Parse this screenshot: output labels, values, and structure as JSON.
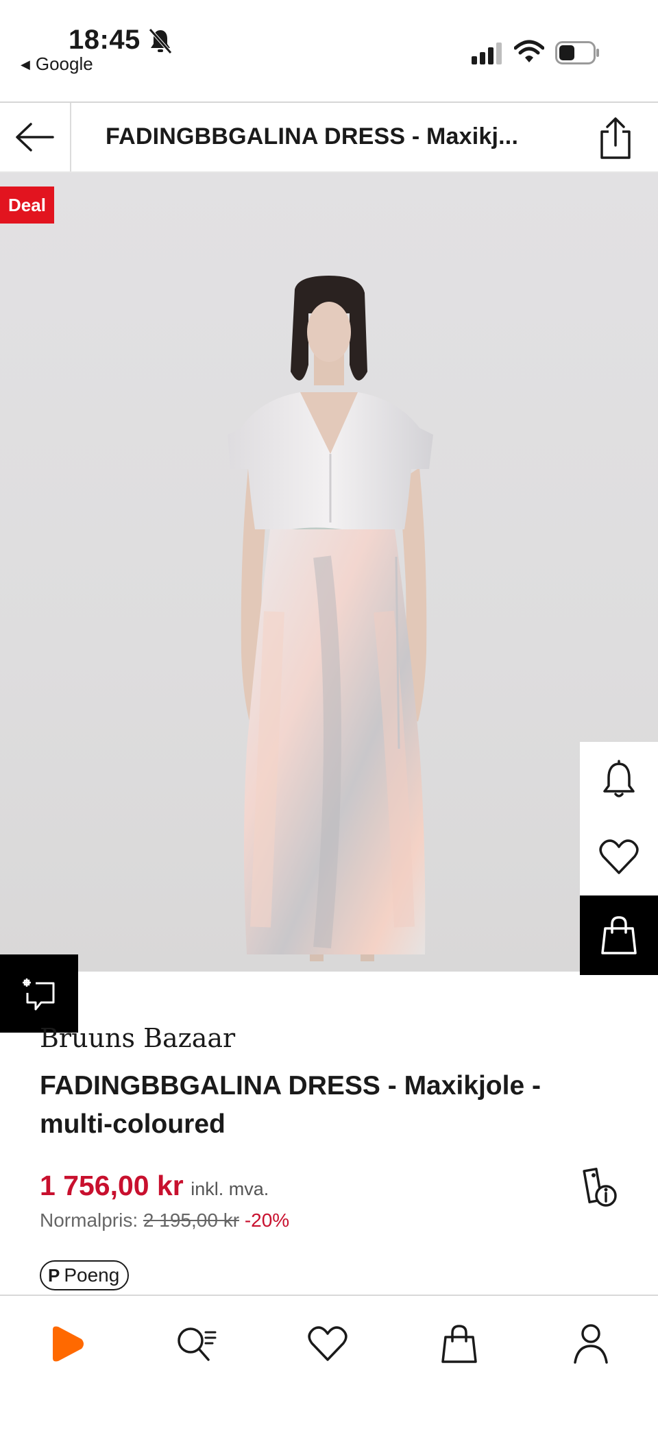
{
  "status_bar": {
    "time": "18:45",
    "back_app": "Google"
  },
  "header": {
    "title": "FADINGBBGALINA DRESS - Maxikj..."
  },
  "badge": {
    "deal": "Deal"
  },
  "product": {
    "brand": "Bruuns Bazaar",
    "name": "FADINGBBGALINA DRESS - Maxikjole - multi-coloured",
    "price": "1 756,00 kr",
    "vat_note": "inkl. mva.",
    "normal_label": "Normalpris:",
    "normal_price": "2 195,00 kr",
    "discount": "-20%",
    "points_label": "Poeng",
    "points_icon": "P"
  },
  "colors": {
    "accent_red": "#c8102e",
    "deal_red": "#e2141f",
    "brand_orange": "#ff6900"
  },
  "icons": {
    "status": [
      "bell-off-icon",
      "signal-icon",
      "wifi-icon",
      "battery-icon"
    ],
    "header": [
      "back-arrow-icon",
      "share-icon"
    ],
    "rail": [
      "notify-bell-icon",
      "wishlist-heart-icon",
      "shopping-bag-icon"
    ],
    "tabs": [
      "home-logo-icon",
      "search-icon",
      "wishlist-icon",
      "bag-icon",
      "account-icon"
    ]
  }
}
